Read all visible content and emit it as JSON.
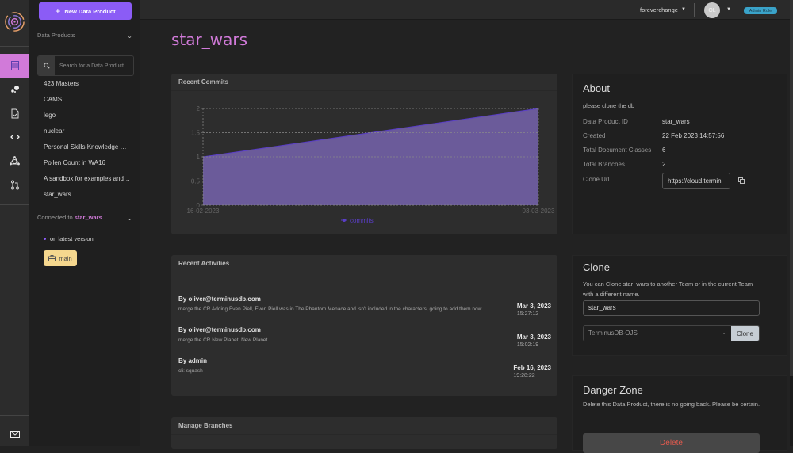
{
  "rail": {
    "icons": [
      "logo-icon",
      "data-product-list-icon",
      "graph-icon",
      "document-icon",
      "code-icon",
      "model-icon",
      "change-request-icon",
      "mail-icon"
    ]
  },
  "sidebar": {
    "new_button": "New Data Product",
    "products_title": "Data Products",
    "search_placeholder": "Search for a Data Product",
    "products": [
      "423 Masters",
      "CAMS",
      "lego",
      "nuclear",
      "Personal Skills Knowledge Gr...",
      "Pollen Count in WA16",
      "A sandbox for examples and r...",
      "star_wars"
    ],
    "connected_label": "Connected to",
    "connected_db": "star_wars",
    "status": "on latest version",
    "branch": "main"
  },
  "topbar": {
    "organization": "foreverchange",
    "avatar_initials": "OL",
    "role_badge": "Admin Role"
  },
  "page": {
    "title": "star_wars"
  },
  "commits": {
    "title": "Recent Commits"
  },
  "chart_data": {
    "type": "area",
    "title": "Recent Commits",
    "x": [
      "16-02-2023",
      "03-03-2023"
    ],
    "series": [
      {
        "name": "commits",
        "values": [
          1,
          2
        ]
      }
    ],
    "yticks": [
      0,
      0.5,
      1,
      1.5,
      2
    ],
    "ylim": [
      0,
      2
    ],
    "xlabel": "",
    "ylabel": "",
    "grid": true,
    "legend": "bottom",
    "colors": {
      "fill": "#6b5b9a",
      "line": "#5a3ec8",
      "legend": "#5a3ec8"
    }
  },
  "activities": {
    "title": "Recent Activities",
    "items": [
      {
        "by": "By oliver@terminusdb.com",
        "message": "merge the CR Adding Even Piell, Even Piell was in The Phantom Menace and isn't included in the characters, going to add them now.",
        "date": "Mar 3, 2023",
        "time": "15:27:12"
      },
      {
        "by": "By oliver@terminusdb.com",
        "message": "merge the CR New Planet, New Planet",
        "date": "Mar 3, 2023",
        "time": "15:02:19"
      },
      {
        "by": "By admin",
        "message": "cli: squash",
        "date": "Feb 16, 2023",
        "time": "19:28:22"
      }
    ]
  },
  "branches": {
    "title": "Manage Branches"
  },
  "about": {
    "title": "About",
    "description": "please clone the db",
    "rows": [
      {
        "label": "Data Product ID",
        "value": "star_wars"
      },
      {
        "label": "Created",
        "value": "22 Feb 2023 14:57:56"
      },
      {
        "label": "Total Document Classes",
        "value": "6"
      },
      {
        "label": "Total Branches",
        "value": "2"
      }
    ],
    "clone_url_label": "Clone Url",
    "clone_url": "https://cloud.termin"
  },
  "clone": {
    "title": "Clone",
    "description": "You can Clone star_wars to another Team or in the current Team with a different name.",
    "name_value": "star_wars",
    "team_value": "TerminusDB-OJS",
    "button": "Clone"
  },
  "danger": {
    "title": "Danger Zone",
    "description": "Delete this Data Product, there is no going back. Please be certain.",
    "button": "Delete"
  }
}
